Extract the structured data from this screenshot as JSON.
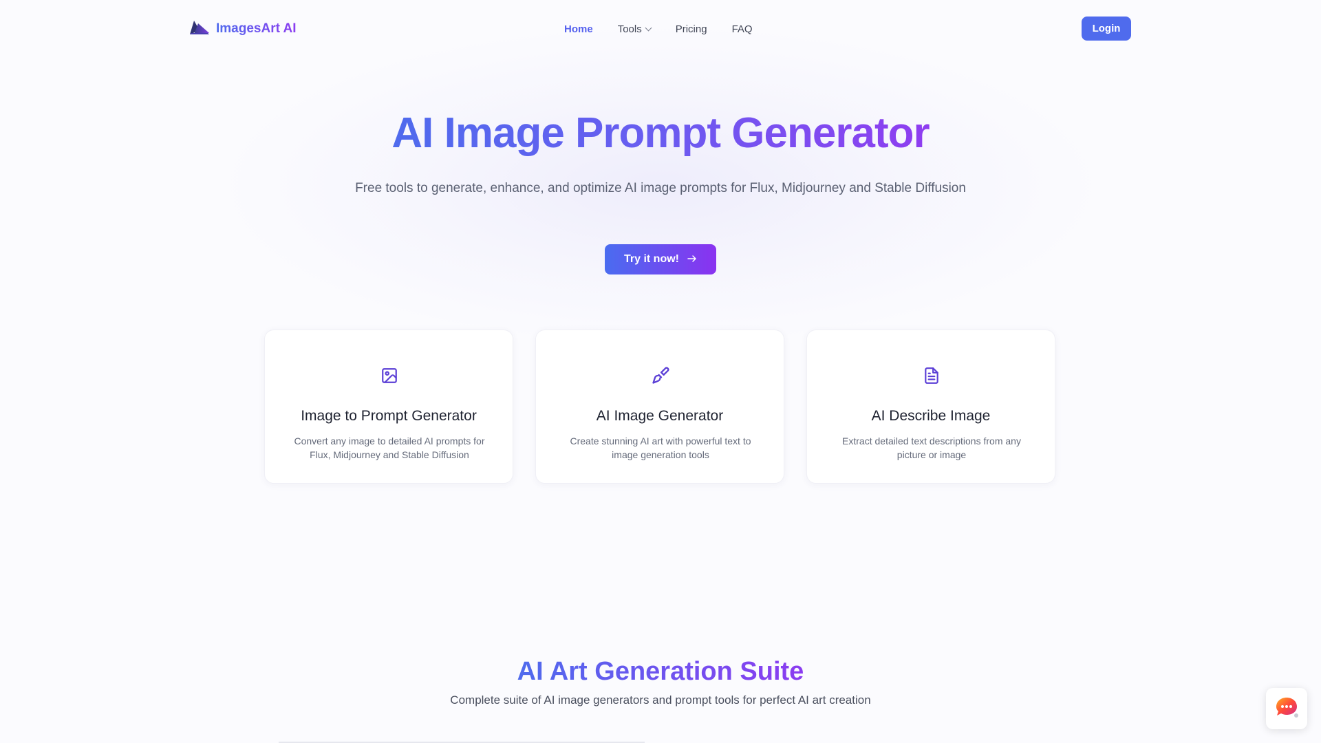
{
  "header": {
    "logo_text": "ImagesArt AI",
    "nav": [
      {
        "label": "Home",
        "active": true
      },
      {
        "label": "Tools",
        "has_dropdown": true
      },
      {
        "label": "Pricing"
      },
      {
        "label": "FAQ"
      }
    ],
    "login_label": "Login"
  },
  "hero": {
    "title": "AI Image Prompt Generator",
    "subtitle": "Free tools to generate, enhance, and optimize AI image prompts for Flux, Midjourney and Stable Diffusion",
    "cta_label": "Try it now!",
    "cta_icon": "arrow-right-icon"
  },
  "cards": [
    {
      "icon": "image-icon",
      "title": "Image to Prompt Generator",
      "description": "Convert any image to detailed AI prompts for Flux, Midjourney and Stable Diffusion"
    },
    {
      "icon": "paintbrush-icon",
      "title": "AI Image Generator",
      "description": "Create stunning AI art with powerful text to image generation tools"
    },
    {
      "icon": "document-icon",
      "title": "AI Describe Image",
      "description": "Extract detailed text descriptions from any picture or image"
    }
  ],
  "suite": {
    "title": "AI Art Generation Suite",
    "subtitle": "Complete suite of AI image generators and prompt tools for perfect AI art creation"
  },
  "colors": {
    "accent": "#4f6bed",
    "gradient_end": "#8b3cf0",
    "active_nav": "#5561ee",
    "icon": "#5b3fd6"
  }
}
